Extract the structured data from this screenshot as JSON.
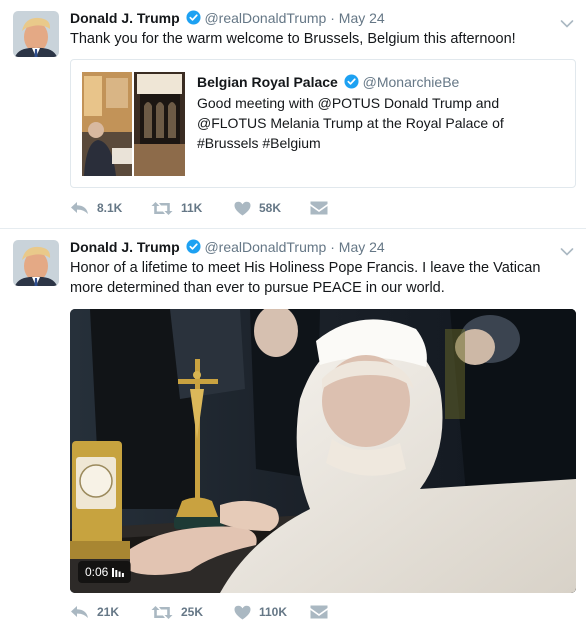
{
  "colors": {
    "link": "#1da1f2",
    "text": "#14171a",
    "muted": "#657786",
    "verified": "#1da1f2",
    "border": "#e1e8ed"
  },
  "tweets": [
    {
      "author": {
        "name": "Donald J. Trump",
        "handle": "@realDonaldTrump",
        "verified": true
      },
      "separator": "·",
      "date": "May 24",
      "text": "Thank you for the warm welcome to Brussels, Belgium this afternoon!",
      "quote": {
        "author": {
          "name": "Belgian Royal Palace",
          "handle": "@MonarchieBe",
          "verified": true
        },
        "text": "Good meeting with @POTUS Donald Trump and @FLOTUS Melania Trump at the Royal Palace of #Brussels #Belgium"
      },
      "actions": {
        "reply": "8.1K",
        "retweet": "11K",
        "like": "58K"
      }
    },
    {
      "author": {
        "name": "Donald J. Trump",
        "handle": "@realDonaldTrump",
        "verified": true
      },
      "separator": "·",
      "date": "May 24",
      "text": "Honor of a lifetime to meet His Holiness Pope Francis. I leave the Vatican more determined than ever to pursue PEACE in our world.",
      "media": {
        "type": "video",
        "duration": "0:06"
      },
      "actions": {
        "reply": "21K",
        "retweet": "25K",
        "like": "110K"
      }
    }
  ]
}
